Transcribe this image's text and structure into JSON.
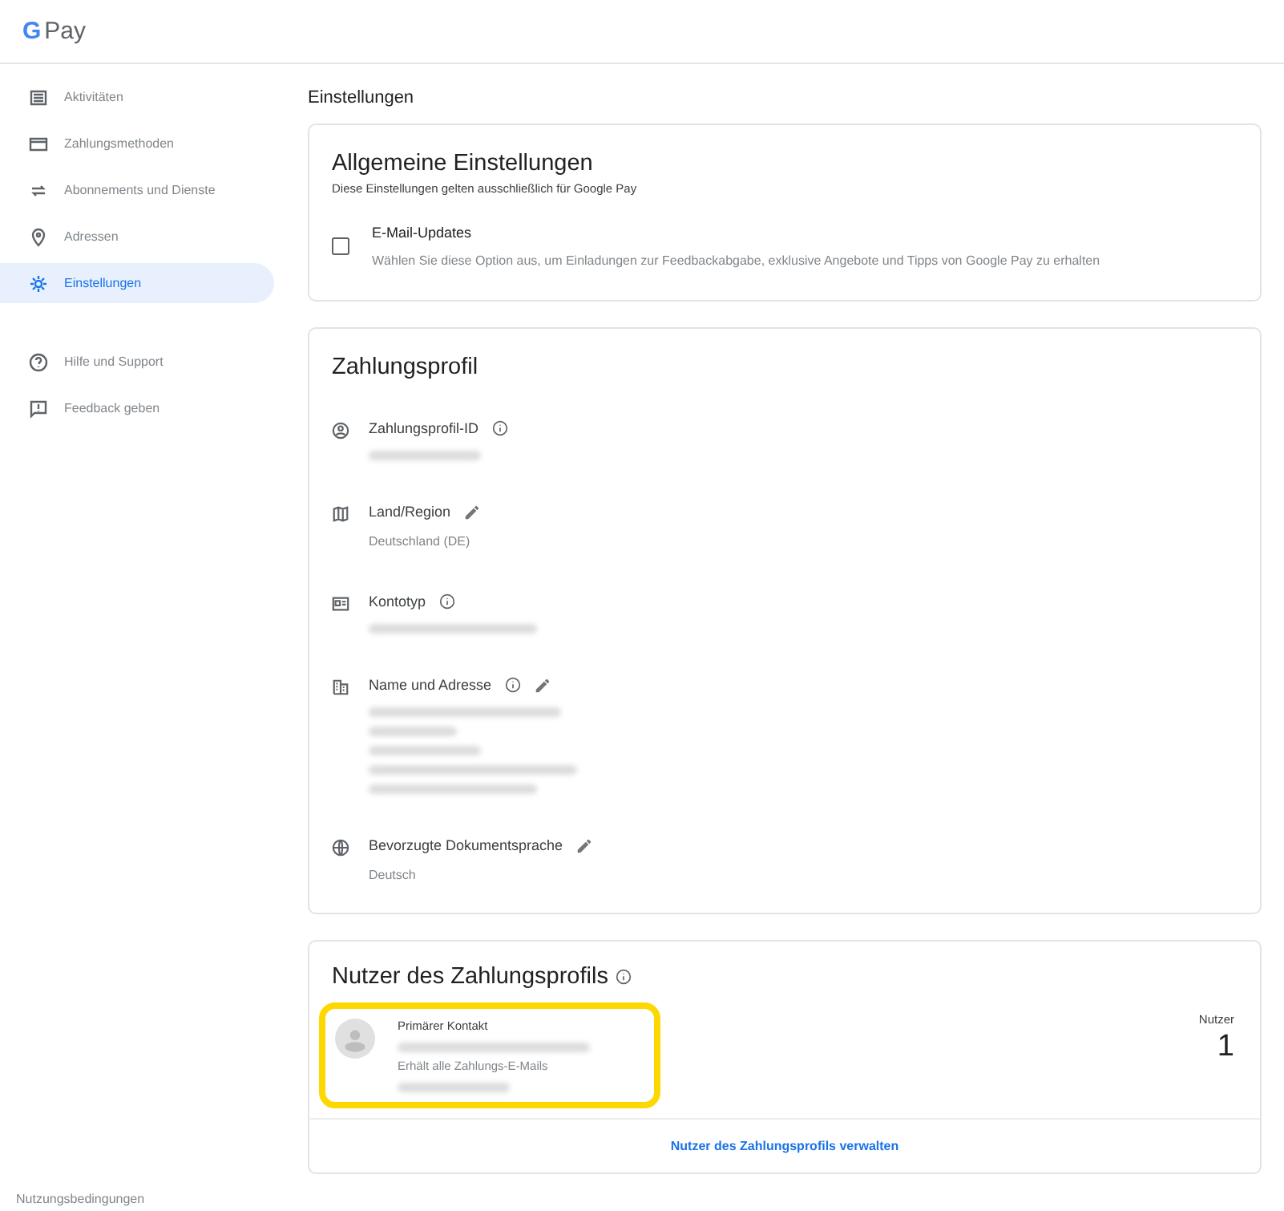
{
  "header": {
    "logo_letter": "G",
    "logo_text": "Pay"
  },
  "sidebar": {
    "items": [
      {
        "label": "Aktivitäten",
        "selected": false
      },
      {
        "label": "Zahlungsmethoden",
        "selected": false
      },
      {
        "label": "Abonnements und Dienste",
        "selected": false
      },
      {
        "label": "Adressen",
        "selected": false
      },
      {
        "label": "Einstellungen",
        "selected": true
      }
    ],
    "secondary_items": [
      {
        "label": "Hilfe und Support"
      },
      {
        "label": "Feedback geben"
      }
    ],
    "footer_link": "Nutzungsbedingungen"
  },
  "page_title": "Einstellungen",
  "general": {
    "title": "Allgemeine Einstellungen",
    "subtitle": "Diese Einstellungen gelten ausschließlich für Google Pay",
    "option": {
      "label": "E-Mail-Updates",
      "description": "Wählen Sie diese Option aus, um Einladungen zur Feedbackabgabe, exklusive Angebote und Tipps von Google Pay zu erhalten",
      "checked": false
    }
  },
  "profile": {
    "title": "Zahlungsprofil",
    "fields": [
      {
        "label": "Zahlungsprofil-ID",
        "info": true,
        "editable": false,
        "lines": [
          {
            "kind": "redacted"
          }
        ]
      },
      {
        "label": "Land/Region",
        "info": false,
        "editable": true,
        "lines": [
          {
            "kind": "text",
            "text": "Deutschland (DE)"
          }
        ]
      },
      {
        "label": "Kontotyp",
        "info": true,
        "editable": false,
        "lines": [
          {
            "kind": "redacted"
          }
        ]
      },
      {
        "label": "Name und Adresse",
        "info": true,
        "editable": true,
        "lines": [
          {
            "kind": "redacted"
          },
          {
            "kind": "redacted"
          },
          {
            "kind": "redacted"
          },
          {
            "kind": "redacted"
          },
          {
            "kind": "redacted"
          }
        ]
      },
      {
        "label": "Bevorzugte Dokumentsprache",
        "info": false,
        "editable": true,
        "lines": [
          {
            "kind": "text",
            "text": "Deutsch"
          }
        ]
      }
    ]
  },
  "users": {
    "title": "Nutzer des Zahlungsprofils",
    "contact": {
      "role": "Primärer Kontakt",
      "highlighted": true,
      "lines": [
        {
          "kind": "redacted"
        },
        {
          "kind": "text",
          "text": "Erhält alle Zahlungs-E-Mails"
        },
        {
          "kind": "redacted"
        }
      ]
    },
    "count_label": "Nutzer",
    "count": "1",
    "manage_link": "Nutzer des Zahlungsprofils verwalten"
  }
}
